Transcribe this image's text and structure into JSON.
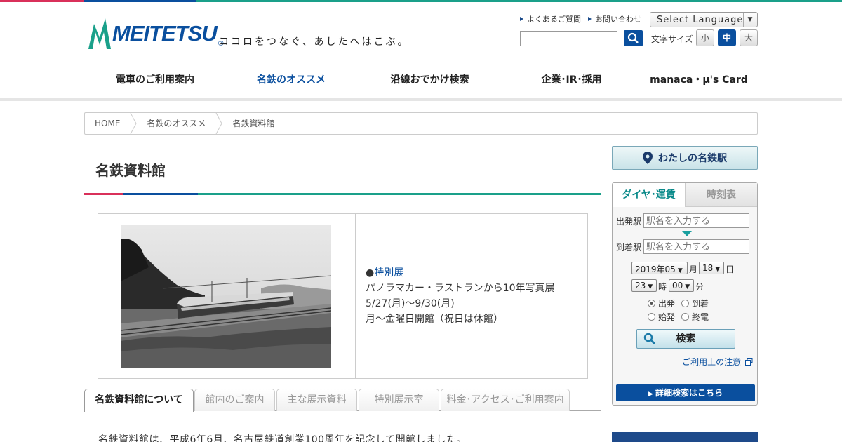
{
  "brand": {
    "logo_text": "MEITETSU",
    "registered": "®",
    "tagline": "ココロをつなぐ、あしたへはこぶ。",
    "colors": {
      "primary": "#0a4f9e",
      "green": "#1aa08a",
      "red": "#d9305a",
      "teal": "#1aa0a0"
    }
  },
  "utility": {
    "faq": "よくあるご質問",
    "contact": "お問い合わせ",
    "language": "Select Language",
    "font_size_label": "文字サイズ",
    "font_sizes": [
      "小",
      "中",
      "大"
    ],
    "font_size_active": "中"
  },
  "gnav": [
    {
      "label": "電車のご利用案内"
    },
    {
      "label": "名鉄のオススメ"
    },
    {
      "label": "沿線おでかけ検索"
    },
    {
      "label": "企業･IR･採用"
    },
    {
      "label": "manaca・μ's Card"
    }
  ],
  "breadcrumb": [
    "HOME",
    "名鉄のオススメ",
    "名鉄資料館"
  ],
  "page": {
    "title": "名鉄資料館",
    "feature": {
      "bullet": "●",
      "link": "特別展",
      "lines": [
        "パノラマカー・ラストランから10年写真展",
        "5/27(月)～9/30(月)",
        "月～金曜日開館（祝日は休館）"
      ]
    },
    "tabs": [
      {
        "label": "名鉄資料館について"
      },
      {
        "label": "館内のご案内"
      },
      {
        "label": "主な展示資料"
      },
      {
        "label": "特別展示室"
      },
      {
        "label": "料金･アクセス･ご利用案内"
      }
    ],
    "intro": "名鉄資料館は、平成6年6月、名古屋鉄道創業100周年を記念して開館しました。"
  },
  "sidebar": {
    "my_meitetsu": "わたしの名鉄駅",
    "tabs": [
      "ダイヤ･運賃",
      "時刻表"
    ],
    "departure_label": "出発駅",
    "arrival_label": "到着駅",
    "station_placeholder": "駅名を入力する",
    "year_month": "2019年05",
    "month_unit": "月",
    "day": "18",
    "day_unit": "日",
    "hour": "23",
    "hour_unit": "時",
    "minute": "00",
    "minute_unit": "分",
    "radios": [
      "出発",
      "到着",
      "始発",
      "終電"
    ],
    "search_label": "検索",
    "notes_link": "ご利用上の注意",
    "detail_link": "詳細検索はこちら"
  }
}
